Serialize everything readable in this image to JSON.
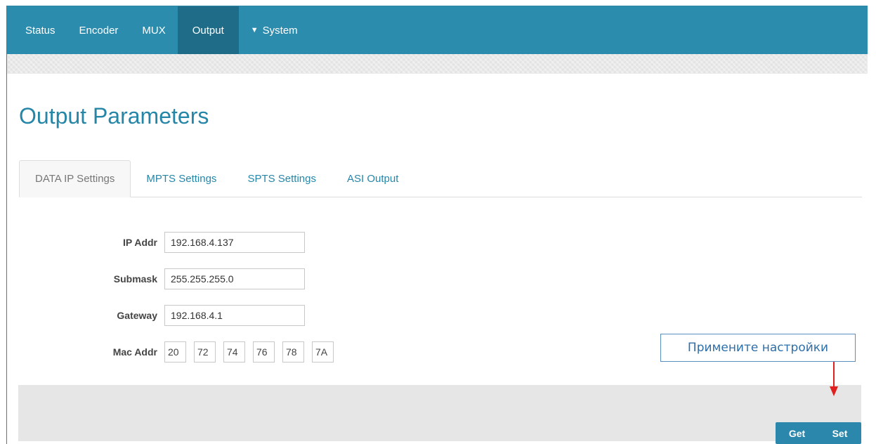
{
  "nav": {
    "items": [
      {
        "label": "Status"
      },
      {
        "label": "Encoder"
      },
      {
        "label": "MUX"
      },
      {
        "label": "Output"
      },
      {
        "label": "System"
      }
    ],
    "active": "Output"
  },
  "page": {
    "title": "Output Parameters"
  },
  "tabs": [
    {
      "label": "DATA IP Settings",
      "active": true
    },
    {
      "label": "MPTS Settings"
    },
    {
      "label": "SPTS Settings"
    },
    {
      "label": "ASI Output"
    }
  ],
  "form": {
    "ip": {
      "label": "IP Addr",
      "value": "192.168.4.137"
    },
    "submask": {
      "label": "Submask",
      "value": "255.255.255.0"
    },
    "gateway": {
      "label": "Gateway",
      "value": "192.168.4.1"
    },
    "mac": {
      "label": "Mac Addr",
      "values": [
        "20",
        "72",
        "74",
        "76",
        "78",
        "7A"
      ]
    }
  },
  "actions": {
    "get_label": "Get",
    "set_label": "Set"
  },
  "callout": {
    "text": "Примените настройки"
  },
  "colors": {
    "navbar": "#2b8cad",
    "nav_active": "#1f6c88",
    "accent": "#2686a8",
    "arrow": "#e0201e"
  }
}
